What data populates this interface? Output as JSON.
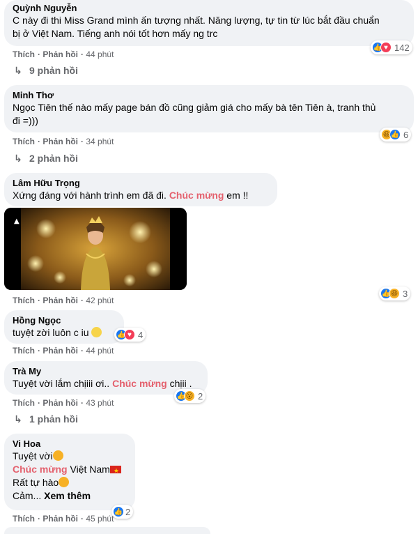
{
  "comments": [
    {
      "author": "Quỳnh Nguyễn",
      "lines": [
        "C này đi thi Miss Grand mình ấn tượng nhất. Năng lượng, tự tin từ lúc bắt đầu chuẩn",
        "bị ở Việt Nam. Tiếng anh nói tốt hơn mấy ng trc"
      ],
      "like": "Thích",
      "reply": "Phản hồi",
      "time": "44 phút",
      "reactions": "142",
      "replies": "9 phản hồi"
    },
    {
      "author": "Minh Thơ",
      "lines": [
        "Ngọc Tiên thế nào mấy page bán đồ cũng giảm giá cho mấy bà tên Tiên à, tranh thủ",
        "đi =)))"
      ],
      "like": "Thích",
      "reply": "Phản hồi",
      "time": "34 phút",
      "reactions": "6",
      "replies": "2 phản hồi"
    },
    {
      "author": "Lâm Hữu Trọng",
      "text_before": "Xứng đáng với hành trình em đã đi.",
      "highlight": "Chúc mừng",
      "text_after": "em !!",
      "like": "Thích",
      "reply": "Phản hồi",
      "time": "42 phút",
      "reactions": "3"
    },
    {
      "author": "Hồng Ngọc",
      "text": "tuyệt zời luôn c iu",
      "like": "Thích",
      "reply": "Phản hồi",
      "time": "44 phút",
      "reactions": "4"
    },
    {
      "author": "Trà My",
      "text_before": "Tuyệt vời lắm chịiii ơi..",
      "highlight": "Chúc mừng",
      "text_after": "chịii .",
      "like": "Thích",
      "reply": "Phản hồi",
      "time": "43 phút",
      "reactions": "2",
      "replies": "1 phản hồi"
    },
    {
      "author": "Vi Hoa",
      "line1": "Tuyệt vời",
      "highlight": "Chúc mừng",
      "line2_after": "Việt Nam",
      "line3": "Rất tự hào",
      "line4_before": "Cảm...",
      "see_more": "Xem thêm",
      "like": "Thích",
      "reply": "Phản hồi",
      "time": "45 phút",
      "reactions": "2"
    }
  ],
  "icons": {
    "reply_arrow": "reply-arrow-icon",
    "like": "like-reaction-icon",
    "love": "love-reaction-icon",
    "haha": "haha-reaction-icon",
    "wow": "wow-reaction-icon"
  },
  "colors": {
    "highlight": "#e4606d",
    "like": "#1877f2",
    "love": "#f33e58",
    "bubble": "#f0f2f5"
  }
}
